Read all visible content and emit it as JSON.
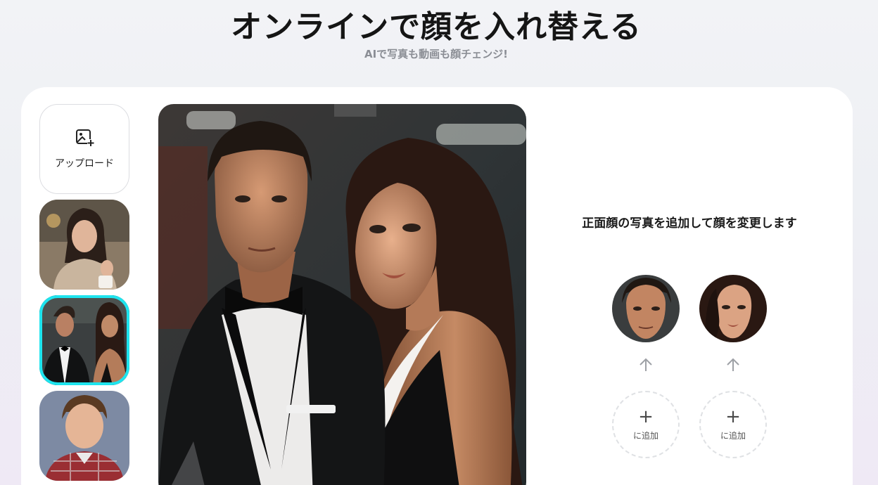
{
  "header": {
    "title": "オンラインで顔を入れ替える",
    "subtitle": "AIで写真も動画も顔チェンジ!"
  },
  "sidebar": {
    "upload_label": "アップロード",
    "thumbnails": [
      {
        "name": "woman-sweater-cafe",
        "selected": false
      },
      {
        "name": "couple-formal",
        "selected": true
      },
      {
        "name": "young-man-plaid",
        "selected": false
      }
    ]
  },
  "panel": {
    "instruction": "正面顔の写真を追加して顔を変更します",
    "slots": [
      {
        "face": "man-face",
        "add_label": "に追加",
        "plus": "+"
      },
      {
        "face": "woman-face",
        "add_label": "に追加",
        "plus": "+"
      }
    ]
  },
  "colors": {
    "accent": "#1ee4ee",
    "card": "#ffffff",
    "dashed_border": "#dfe1e4"
  }
}
